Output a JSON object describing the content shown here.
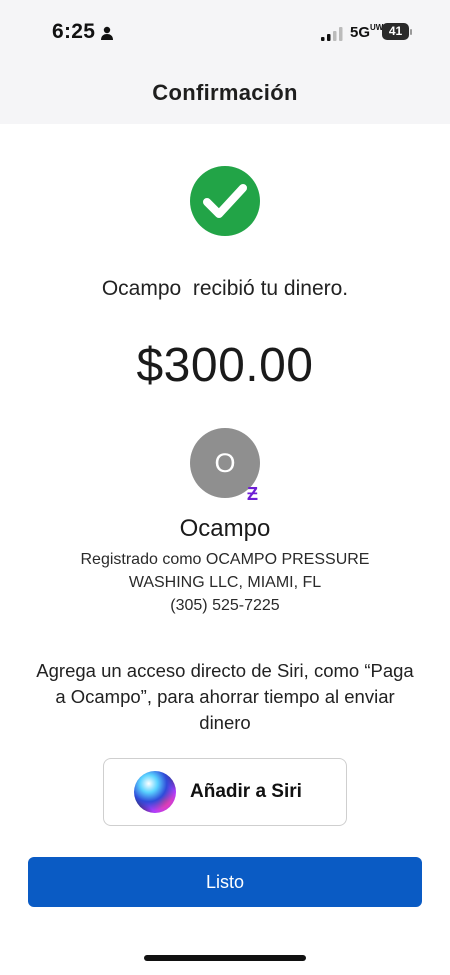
{
  "status_bar": {
    "time": "6:25",
    "network": "5G",
    "network_sup": "UW",
    "battery": "41"
  },
  "nav": {
    "title": "Confirmación"
  },
  "confirmation": {
    "received_text": "Ocampo  recibió tu dinero.",
    "amount": "$300.00"
  },
  "recipient": {
    "avatar_initial": "O",
    "name": "Ocampo",
    "registered_line_1": "Registrado como OCAMPO PRESSURE",
    "registered_line_2": "WASHING LLC, MIAMI, FL",
    "phone": "(305) 525-7225",
    "badge_glyph": "Ƶ"
  },
  "siri": {
    "prompt": "Agrega un acceso directo de Siri, como “Paga a Ocampo”, para ahorrar tiempo al enviar dinero",
    "button_label": "Añadir a Siri"
  },
  "actions": {
    "done_label": "Listo"
  },
  "colors": {
    "success_green": "#22a447",
    "zelle_purple": "#6d1ed4",
    "primary_blue": "#0a5bc4",
    "avatar_gray": "#8f8f8f"
  }
}
